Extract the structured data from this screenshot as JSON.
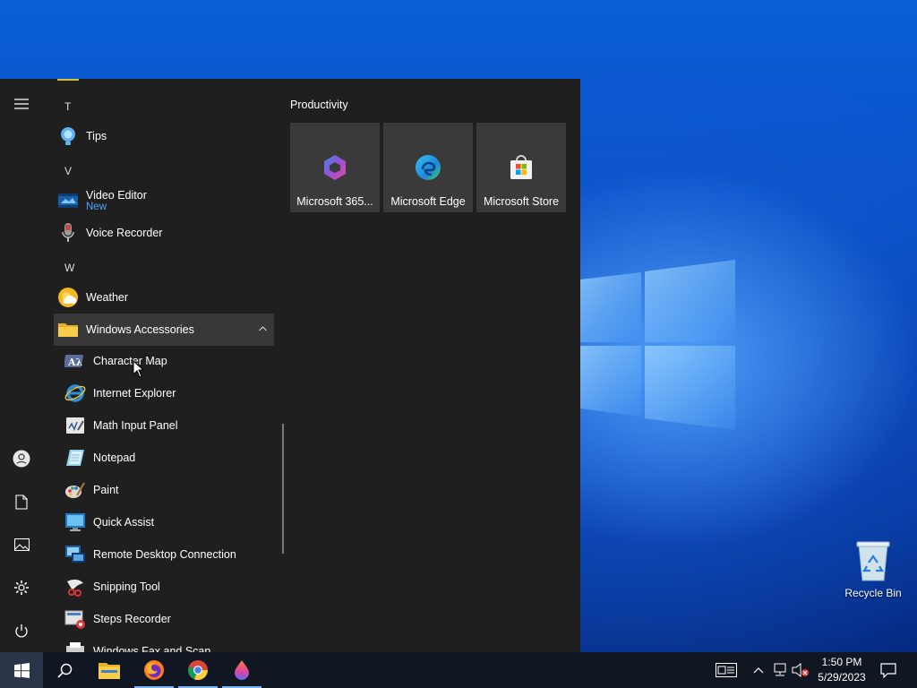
{
  "desktop": {
    "recycle_bin_label": "Recycle Bin"
  },
  "start_menu": {
    "rail": [
      {
        "name": "expand",
        "icon": "hamburger-icon"
      },
      {
        "name": "account",
        "icon": "user-icon"
      },
      {
        "name": "documents",
        "icon": "document-icon"
      },
      {
        "name": "pictures",
        "icon": "pictures-icon"
      },
      {
        "name": "settings",
        "icon": "gear-icon"
      },
      {
        "name": "power",
        "icon": "power-icon"
      }
    ],
    "letters": {
      "t": "T",
      "v": "V",
      "w": "W"
    },
    "apps": {
      "tips": "Tips",
      "video_editor": "Video Editor",
      "video_editor_badge": "New",
      "voice_recorder": "Voice Recorder",
      "weather": "Weather",
      "windows_accessories": "Windows Accessories",
      "character_map": "Character Map",
      "internet_explorer": "Internet Explorer",
      "math_input_panel": "Math Input Panel",
      "notepad": "Notepad",
      "paint": "Paint",
      "quick_assist": "Quick Assist",
      "remote_desktop": "Remote Desktop Connection",
      "snipping_tool": "Snipping Tool",
      "steps_recorder": "Steps Recorder",
      "windows_fax": "Windows Fax and Scan"
    },
    "tiles_group_title": "Productivity",
    "tiles": {
      "m365": "Microsoft 365...",
      "edge": "Microsoft Edge",
      "store": "Microsoft Store"
    }
  },
  "taskbar": {
    "pinned": [
      "start",
      "search",
      "file-explorer",
      "firefox",
      "chrome",
      "app"
    ],
    "clock_time": "1:50 PM",
    "clock_date": "5/29/2023"
  },
  "colors": {
    "accent": "#4aa3ff",
    "menu_bg": "#1f1f1f",
    "tile_bg": "#3a3a3a",
    "taskbar_bg": "#101622"
  }
}
